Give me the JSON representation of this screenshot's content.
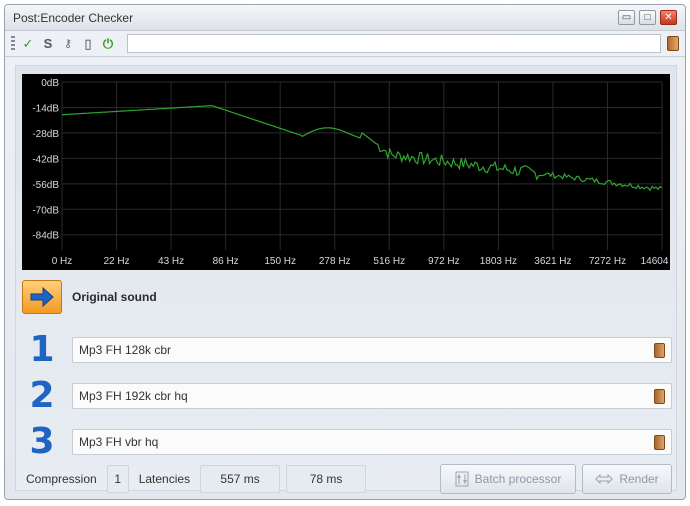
{
  "window": {
    "title": "Post:Encoder Checker"
  },
  "toolbar": {
    "icons": [
      "checkmark-icon",
      "s-icon",
      "key-icon",
      "bracket-icon",
      "power-icon",
      "book-icon"
    ],
    "path_value": ""
  },
  "spectrum": {
    "y_ticks": [
      "0dB",
      "-14dB",
      "-28dB",
      "-42dB",
      "-56dB",
      "-70dB",
      "-84dB"
    ],
    "x_ticks": [
      "0 Hz",
      "22 Hz",
      "43 Hz",
      "86 Hz",
      "150 Hz",
      "278 Hz",
      "516 Hz",
      "972 Hz",
      "1803 Hz",
      "3621 Hz",
      "7272 Hz",
      "14604 Hz"
    ],
    "trace_color": "#2fa52f",
    "grid_color": "#2a2a2a"
  },
  "original": {
    "label": "Original sound"
  },
  "codecs": [
    {
      "number": "1",
      "value": "Mp3 FH 128k cbr"
    },
    {
      "number": "2",
      "value": "Mp3 FH 192k cbr hq"
    },
    {
      "number": "3",
      "value": "Mp3 FH vbr hq"
    }
  ],
  "status": {
    "compression_label": "Compression",
    "compression_value": "1",
    "latencies_label": "Latencies",
    "latency_1": "557 ms",
    "latency_2": "78 ms",
    "batch_label": "Batch processor",
    "render_label": "Render"
  },
  "colors": {
    "accent_number": "#1f63c4",
    "original_button": "#f39a21"
  }
}
